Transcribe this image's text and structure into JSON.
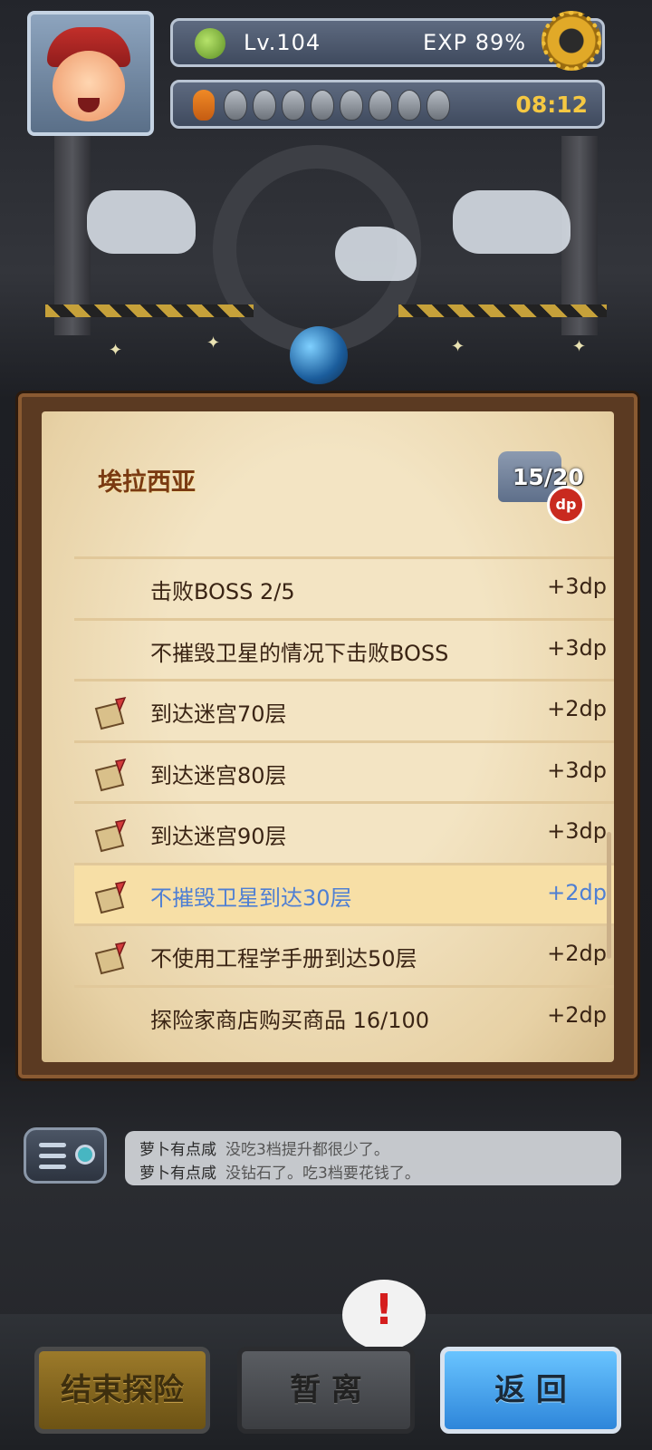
{
  "hud": {
    "level": "Lv.104",
    "exp": "EXP 89%",
    "timer": "08:12",
    "icons": [
      "leaf-icon",
      "gear-icon",
      "carrot-icon",
      "seed-icon"
    ]
  },
  "panel": {
    "title": "埃拉西亚",
    "dp_count": "15/20",
    "dp_badge": "dp",
    "rows": [
      {
        "text": "击败BOSS 2/5",
        "reward": "+3dp",
        "quill": false,
        "highlight": false
      },
      {
        "text": "不摧毁卫星的情况下击败BOSS",
        "reward": "+3dp",
        "quill": false,
        "highlight": false
      },
      {
        "text": "到达迷宫70层",
        "reward": "+2dp",
        "quill": true,
        "highlight": false
      },
      {
        "text": "到达迷宫80层",
        "reward": "+3dp",
        "quill": true,
        "highlight": false
      },
      {
        "text": "到达迷宫90层",
        "reward": "+3dp",
        "quill": true,
        "highlight": false
      },
      {
        "text": "不摧毁卫星到达30层",
        "reward": "+2dp",
        "quill": true,
        "highlight": true
      },
      {
        "text": "不使用工程学手册到达50层",
        "reward": "+2dp",
        "quill": true,
        "highlight": false
      },
      {
        "text": "探险家商店购买商品 16/100",
        "reward": "+2dp",
        "quill": false,
        "highlight": false
      }
    ]
  },
  "chat": {
    "messages": [
      {
        "name": "萝卜有点咸",
        "text": "没吃3档提升都很少了。"
      },
      {
        "name": "萝卜有点咸",
        "text": "没钻石了。吃3档要花钱了。"
      }
    ]
  },
  "buttons": {
    "end": "结束探险",
    "pause": "暂 离",
    "back": "返 回"
  },
  "alert": "!"
}
